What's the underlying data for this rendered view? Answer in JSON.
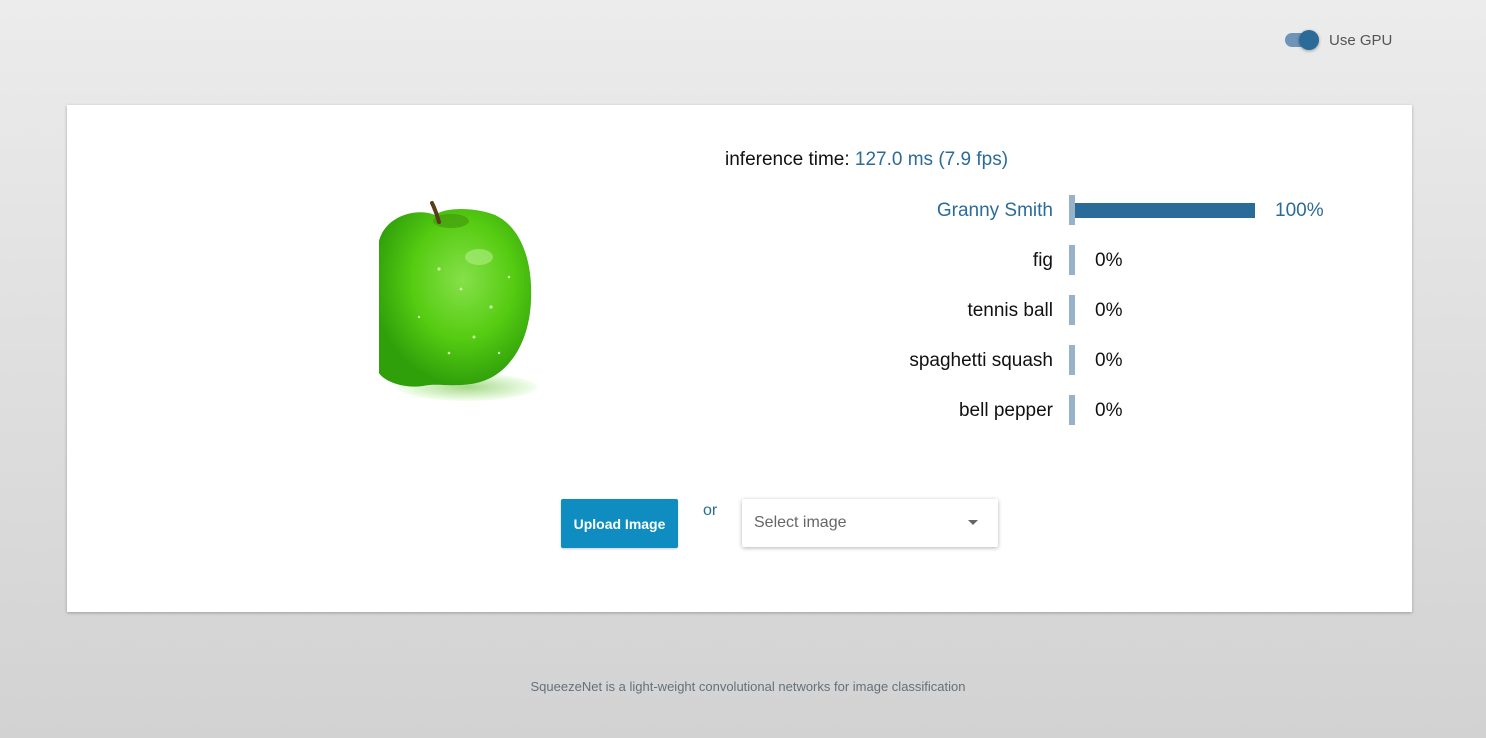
{
  "settings": {
    "gpu_label": "Use GPU",
    "gpu_enabled": true,
    "accent_color": "#2b6b9a"
  },
  "inference": {
    "label": "inference time:",
    "value": "127.0 ms (7.9 fps)"
  },
  "preview": {
    "subject": "green apple"
  },
  "predictions": [
    {
      "label": "Granny Smith",
      "value": "100%",
      "fraction": 1.0
    },
    {
      "label": "fig",
      "value": "0%",
      "fraction": 0.0
    },
    {
      "label": "tennis ball",
      "value": "0%",
      "fraction": 0.0
    },
    {
      "label": "spaghetti squash",
      "value": "0%",
      "fraction": 0.0
    },
    {
      "label": "bell pepper",
      "value": "0%",
      "fraction": 0.0
    }
  ],
  "controls": {
    "upload_label": "Upload Image",
    "or_text": "or",
    "select_placeholder": "Select image",
    "upload_color": "#0f8cc0"
  },
  "footer": {
    "text": "SqueezeNet is a light-weight convolutional networks for image classification"
  }
}
